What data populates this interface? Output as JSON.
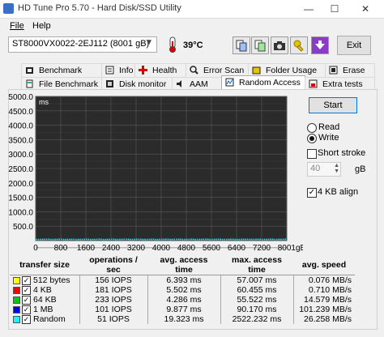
{
  "window": {
    "title": "HD Tune Pro 5.70 - Hard Disk/SSD Utility",
    "controls": {
      "minimize": "—",
      "maximize": "☐",
      "close": "✕"
    }
  },
  "menu": {
    "file": "File",
    "help": "Help"
  },
  "toolbar": {
    "drive": "ST8000VX0022-2EJ112 (8001 gB)",
    "temperature": "39°C",
    "exit_label": "Exit"
  },
  "tabs_row1": [
    {
      "label": "Benchmark",
      "icon": "benchmark-icon"
    },
    {
      "label": "Info",
      "icon": "info-icon"
    },
    {
      "label": "Health",
      "icon": "health-cross-icon"
    },
    {
      "label": "Error Scan",
      "icon": "error-scan-icon"
    },
    {
      "label": "Folder Usage",
      "icon": "folder-icon"
    },
    {
      "label": "Erase",
      "icon": "erase-icon"
    }
  ],
  "tabs_row2": [
    {
      "label": "File Benchmark",
      "icon": "file-benchmark-icon"
    },
    {
      "label": "Disk monitor",
      "icon": "disk-monitor-icon"
    },
    {
      "label": "AAM",
      "icon": "speaker-icon"
    },
    {
      "label": "Random Access",
      "icon": "random-access-icon",
      "active": true
    },
    {
      "label": "Extra tests",
      "icon": "extra-tests-icon"
    }
  ],
  "controls": {
    "start_label": "Start",
    "read_label": "Read",
    "write_label": "Write",
    "mode_selected": "Write",
    "short_stroke_label": "Short stroke",
    "short_stroke_checked": false,
    "short_stroke_value": "40",
    "short_stroke_unit": "gB",
    "align_label": "4 KB align",
    "align_checked": true
  },
  "chart_data": {
    "type": "scatter",
    "ylabel": "ms",
    "y_ticks": [
      "5000.0",
      "4500.0",
      "4000.0",
      "3500.0",
      "3000.0",
      "2500.0",
      "2000.0",
      "1500.0",
      "1000.0",
      "500.0"
    ],
    "x_ticks": [
      "0",
      "800",
      "1600",
      "2400",
      "3200",
      "4000",
      "4800",
      "5600",
      "6400",
      "7200",
      "8001gB"
    ],
    "ylim": [
      0,
      5000
    ],
    "xlim": [
      0,
      8001
    ],
    "grid": true,
    "background": "#2b2b2b",
    "series": [
      {
        "color": "#ffff00",
        "base_ms": 6.4
      },
      {
        "color": "#ff0000",
        "base_ms": 5.5
      },
      {
        "color": "#00ff00",
        "base_ms": 4.3
      },
      {
        "color": "#0000ff",
        "base_ms": 9.9
      },
      {
        "color": "#00ffff",
        "base_ms": 19.3
      }
    ]
  },
  "table": {
    "headers": [
      "transfer size",
      "operations / sec",
      "avg. access time",
      "max. access time",
      "avg. speed"
    ],
    "rows": [
      {
        "color": "#ffff00",
        "checked": true,
        "size": "512 bytes",
        "ops": "156 IOPS",
        "avg": "6.393 ms",
        "max": "57.007 ms",
        "speed": "0.076 MB/s"
      },
      {
        "color": "#ff0000",
        "checked": true,
        "size": "4 KB",
        "ops": "181 IOPS",
        "avg": "5.502 ms",
        "max": "60.455 ms",
        "speed": "0.710 MB/s"
      },
      {
        "color": "#00cc00",
        "checked": true,
        "size": "64 KB",
        "ops": "233 IOPS",
        "avg": "4.286 ms",
        "max": "55.522 ms",
        "speed": "14.579 MB/s"
      },
      {
        "color": "#0000ff",
        "checked": true,
        "size": "1 MB",
        "ops": "101 IOPS",
        "avg": "9.877 ms",
        "max": "90.170 ms",
        "speed": "101.239 MB/s"
      },
      {
        "color": "#00ffff",
        "checked": true,
        "size": "Random",
        "ops": "51 IOPS",
        "avg": "19.323 ms",
        "max": "2522.232 ms",
        "speed": "26.258 MB/s"
      }
    ]
  }
}
